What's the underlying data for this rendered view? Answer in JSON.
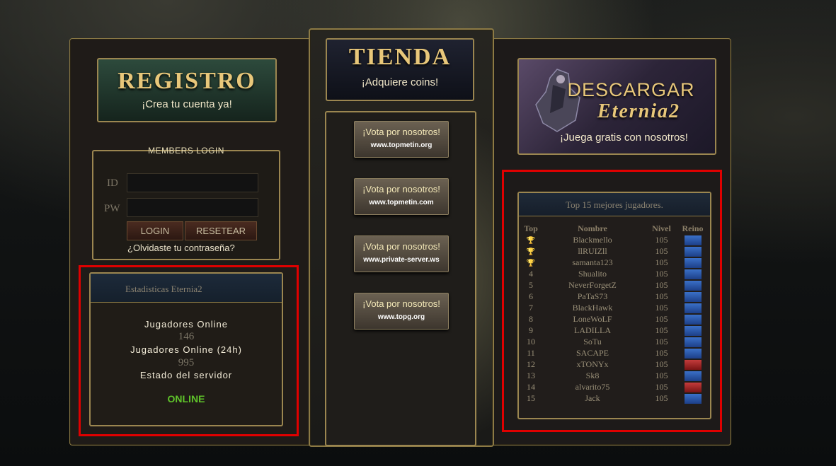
{
  "registro": {
    "title": "REGISTRO",
    "subtitle": "¡Crea tu cuenta ya!"
  },
  "tienda": {
    "title": "TIENDA",
    "subtitle": "¡Adquiere coins!"
  },
  "descargar": {
    "title_line1": "DESCARGAR",
    "title_line2": "Eternia2",
    "subtitle": "¡Juega gratis con nosotros!"
  },
  "login": {
    "title": "MEMBERS LOGIN",
    "id_label": "ID",
    "pw_label": "PW",
    "login_button": "LOGIN",
    "reset_button": "RESETEAR",
    "forgot_link": "¿Olvidaste tu contraseña?"
  },
  "stats": {
    "title": "Estadisticas Eternia2",
    "online_label": "Jugadores Online",
    "online_value": "146",
    "online24_label": "Jugadores Online (24h)",
    "online24_value": "995",
    "server_label": "Estado del servidor",
    "server_status": "ONLINE",
    "status_color": "#5fc42a"
  },
  "vote": [
    {
      "line1": "¡Vota por nosotros!",
      "line2": "www.topmetin.org"
    },
    {
      "line1": "¡Vota por nosotros!",
      "line2": "www.topmetin.com"
    },
    {
      "line1": "¡Vota por nosotros!",
      "line2": "www.private-server.ws"
    },
    {
      "line1": "¡Vota por nosotros!",
      "line2": "www.topg.org"
    }
  ],
  "ranking": {
    "title": "Top 15 mejores jugadores.",
    "headers": [
      "Top",
      "Nombre",
      "Nivel",
      "Reino"
    ],
    "rows": [
      {
        "top": "trophy",
        "name": "Blackmello",
        "level": "105",
        "realm": "blue"
      },
      {
        "top": "trophy",
        "name": "llRUIZll",
        "level": "105",
        "realm": "blue"
      },
      {
        "top": "trophy",
        "name": "samanta123",
        "level": "105",
        "realm": "blue"
      },
      {
        "top": "4",
        "name": "Shualito",
        "level": "105",
        "realm": "blue"
      },
      {
        "top": "5",
        "name": "NeverForgetZ",
        "level": "105",
        "realm": "blue"
      },
      {
        "top": "6",
        "name": "PaTaS73",
        "level": "105",
        "realm": "blue"
      },
      {
        "top": "7",
        "name": "BlackHawk",
        "level": "105",
        "realm": "blue"
      },
      {
        "top": "8",
        "name": "LoneWoLF",
        "level": "105",
        "realm": "blue"
      },
      {
        "top": "9",
        "name": "LADILLA",
        "level": "105",
        "realm": "blue"
      },
      {
        "top": "10",
        "name": "SoTu",
        "level": "105",
        "realm": "blue"
      },
      {
        "top": "11",
        "name": "SACAPE",
        "level": "105",
        "realm": "blue"
      },
      {
        "top": "12",
        "name": "xTONYx",
        "level": "105",
        "realm": "red"
      },
      {
        "top": "13",
        "name": "Sk8",
        "level": "105",
        "realm": "blue"
      },
      {
        "top": "14",
        "name": "alvarito75",
        "level": "105",
        "realm": "red"
      },
      {
        "top": "15",
        "name": "Jack",
        "level": "105",
        "realm": "blue"
      }
    ]
  },
  "colors": {
    "gold": "#e8c77a",
    "highlight": "#e00000",
    "realm_blue": "#2a5ab0",
    "realm_red": "#a02424"
  }
}
